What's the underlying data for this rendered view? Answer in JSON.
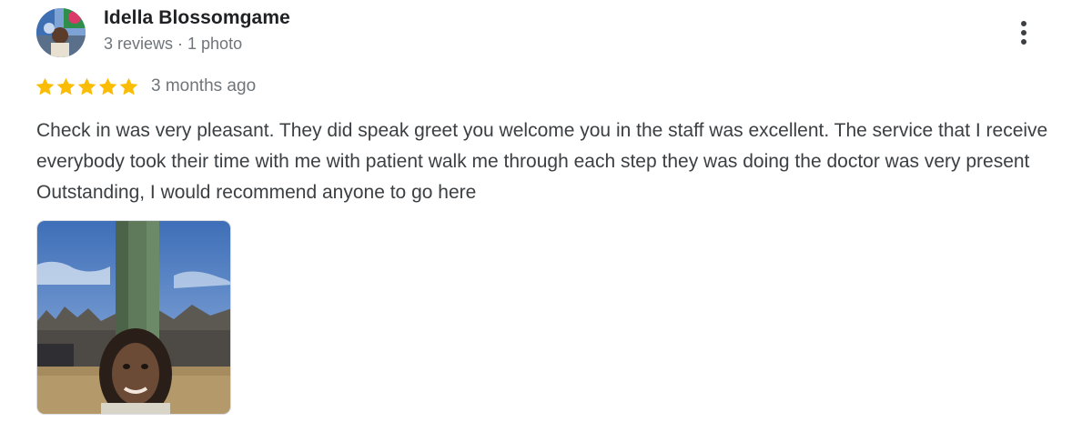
{
  "review": {
    "author": {
      "name": "Idella Blossomgame",
      "meta": "3 reviews · 1 photo",
      "avatar_icon": "user-avatar-photo"
    },
    "rating": {
      "stars": 5,
      "max_stars": 5,
      "star_color": "#fbbc04",
      "date": "3 months ago"
    },
    "text": "Check in was very pleasant. They did speak greet you welcome you in the staff was excellent. The service that I receive everybody took their time with me with patient walk me through each step they was doing the doctor was very present Outstanding, I would recommend anyone to go here",
    "more_icon": "more-vert-icon",
    "photos": [
      {
        "icon": "review-photo-thumbnail"
      }
    ]
  }
}
